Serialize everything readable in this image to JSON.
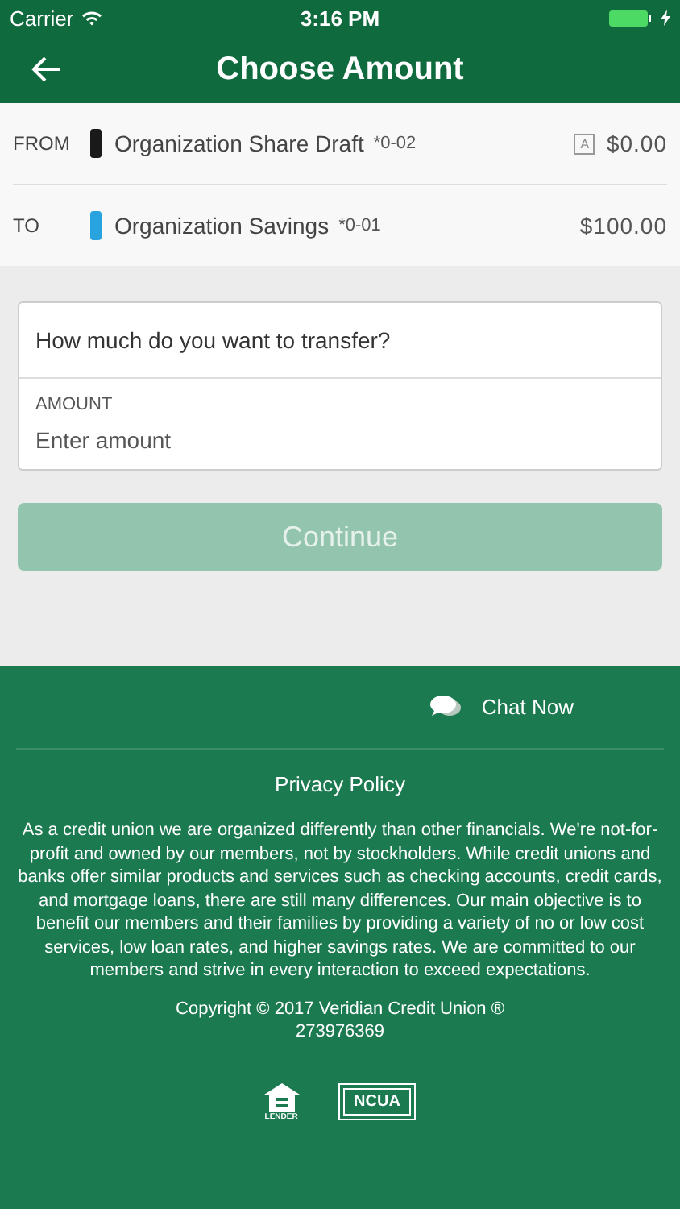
{
  "status_bar": {
    "carrier": "Carrier",
    "time": "3:16 PM",
    "charging": true
  },
  "header": {
    "title": "Choose Amount"
  },
  "accounts": [
    {
      "direction": "FROM",
      "name": "Organization Share Draft",
      "number": "*0-02",
      "color": "#1a1a1a",
      "badge": "A",
      "balance": "$0.00"
    },
    {
      "direction": "TO",
      "name": "Organization Savings",
      "number": "*0-01",
      "color": "#29a3e0",
      "balance": "$100.00"
    }
  ],
  "form": {
    "question": "How much do you want to transfer?",
    "amount_label": "AMOUNT",
    "amount_placeholder": "Enter amount"
  },
  "continue_button": {
    "label": "Continue",
    "disabled": true
  },
  "footer": {
    "chat": "Chat Now",
    "privacy": "Privacy Policy",
    "about": "As a credit union we are organized differently than other financials. We're not-for-profit and owned by our members, not by stockholders. While credit unions and banks offer similar products and services such as checking accounts, credit cards, and mortgage loans, there are still many differences. Our main objective is to benefit our members and their families by providing a variety of no or low cost services, low loan rates, and higher savings rates. We are committed to our members and strive in every interaction to exceed expectations.",
    "copyright": "Copyright © 2017 Veridian Credit Union ®",
    "routing": "273976369",
    "lender_label": "LENDER",
    "ncua": "NCUA"
  }
}
